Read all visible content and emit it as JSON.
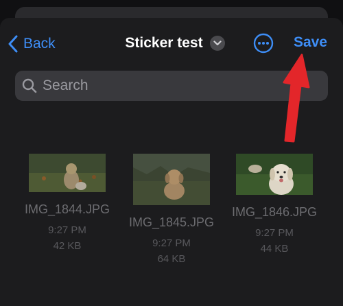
{
  "header": {
    "back_label": "Back",
    "title": "Sticker test",
    "save_label": "Save"
  },
  "search": {
    "placeholder": "Search"
  },
  "files": [
    {
      "name": "IMG_1844.JPG",
      "time": "9:27 PM",
      "size": "42 KB"
    },
    {
      "name": "IMG_1845.JPG",
      "time": "9:27 PM",
      "size": "64 KB"
    },
    {
      "name": "IMG_1846.JPG",
      "time": "9:27 PM",
      "size": "44 KB"
    }
  ],
  "colors": {
    "accent": "#3e8ef7",
    "annotation_arrow": "#e3262a"
  },
  "icons": [
    "chevron-left-icon",
    "chevron-down-icon",
    "more-icon",
    "search-icon",
    "arrow-annotation"
  ]
}
